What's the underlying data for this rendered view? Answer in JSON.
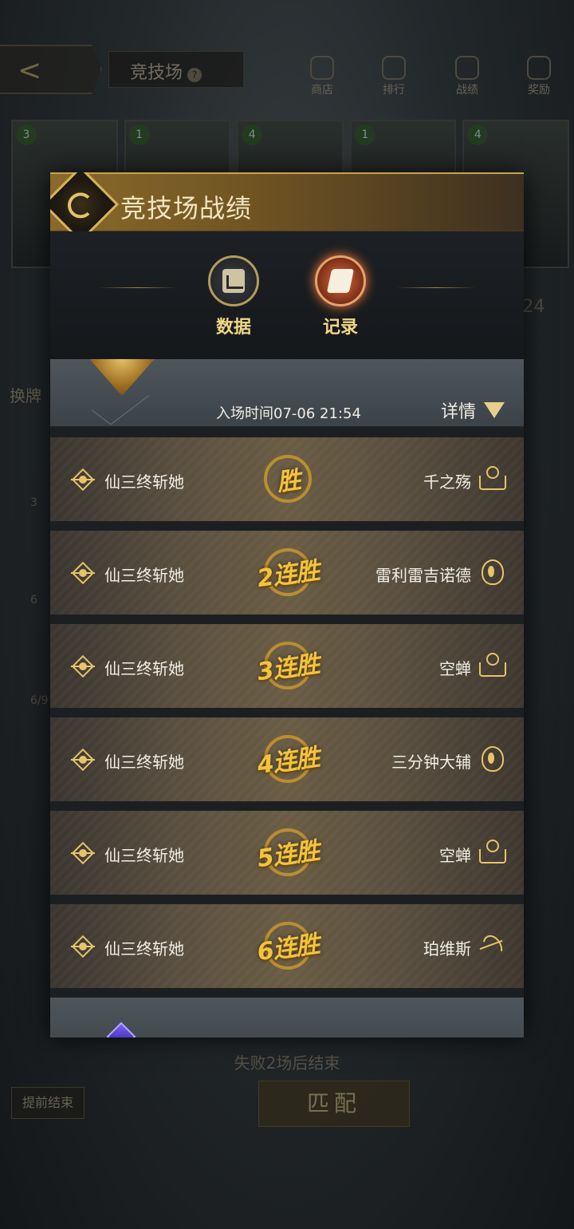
{
  "background": {
    "back_label": "<",
    "title": "竞技场",
    "help_mark": "?",
    "nav": [
      {
        "label": "商店",
        "icon": "shop-icon"
      },
      {
        "label": "排行",
        "icon": "trophy-icon"
      },
      {
        "label": "战绩",
        "icon": "record-icon"
      },
      {
        "label": "奖励",
        "icon": "reward-icon"
      }
    ],
    "card_levels": [
      "3",
      "1",
      "4",
      "1",
      "4"
    ],
    "side_text": "换牌",
    "count_text": "/24",
    "small_text_1": "3",
    "small_text_2": "6",
    "small_text_3": "6/9",
    "bottom_text": "失败2场后结束",
    "end_button": "提前结束",
    "match_button": "匹配"
  },
  "modal": {
    "title": "竞技场战绩",
    "crest_icon": "arena-crest-icon",
    "tabs": [
      {
        "label": "数据",
        "icon": "chart-icon",
        "active": false
      },
      {
        "label": "记录",
        "icon": "quill-icon",
        "active": true
      }
    ]
  },
  "session": {
    "entry_time": "入场时间07-06 21:54",
    "details_label": "详情",
    "medal_icon": "rank-medal-icon"
  },
  "matches": [
    {
      "player": "仙三终斩她",
      "result": "胜",
      "opponent": "千之殇",
      "opponent_class": "book-icon"
    },
    {
      "player": "仙三终斩她",
      "result": "2连胜",
      "opponent": "雷利雷吉诺德",
      "opponent_class": "flame-icon"
    },
    {
      "player": "仙三终斩她",
      "result": "3连胜",
      "opponent": "空蝉",
      "opponent_class": "book-icon"
    },
    {
      "player": "仙三终斩她",
      "result": "4连胜",
      "opponent": "三分钟大辅",
      "opponent_class": "flame-icon"
    },
    {
      "player": "仙三终斩她",
      "result": "5连胜",
      "opponent": "空蝉",
      "opponent_class": "book-icon"
    },
    {
      "player": "仙三终斩她",
      "result": "6连胜",
      "opponent": "珀维斯",
      "opponent_class": "bow-icon"
    }
  ],
  "colors": {
    "gold": "#e6c46a",
    "win_text": "#f3c33e",
    "header_gold": "#8a6a2a"
  }
}
